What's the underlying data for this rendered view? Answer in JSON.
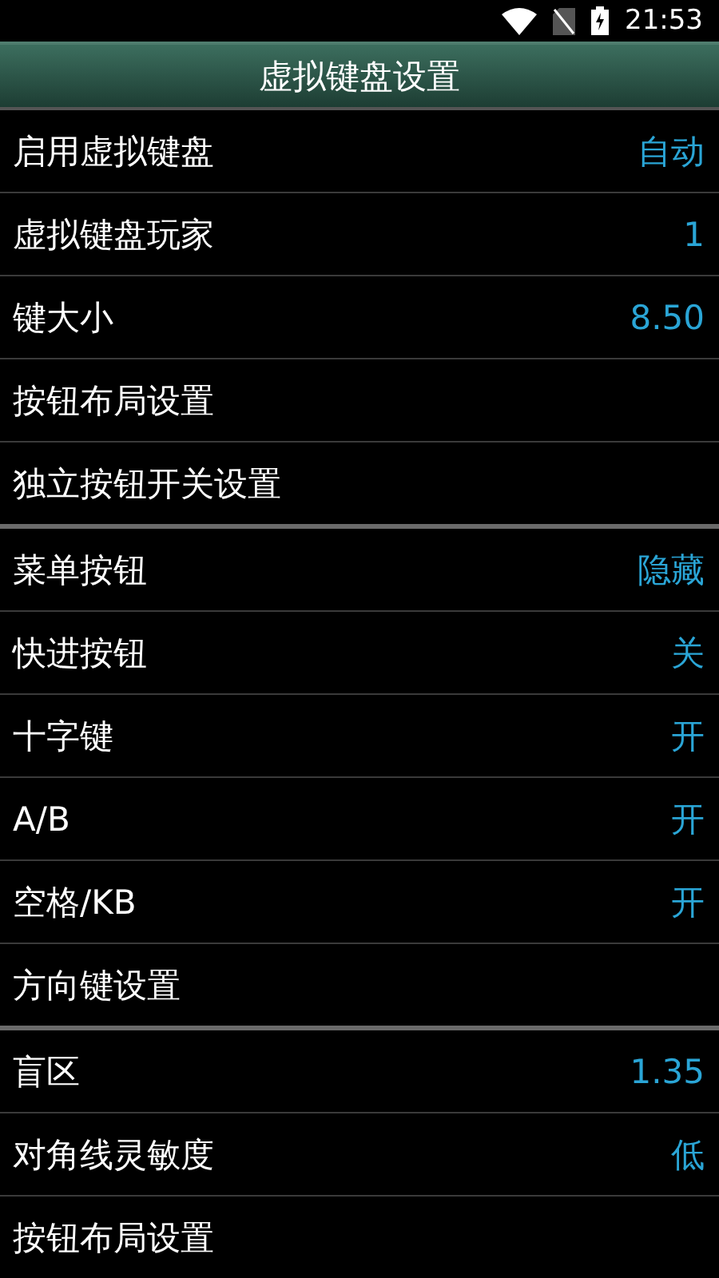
{
  "status_bar": {
    "time": "21:53"
  },
  "header": {
    "title": "虚拟键盘设置"
  },
  "groups": [
    {
      "items": [
        {
          "label": "启用虚拟键盘",
          "value": "自动"
        },
        {
          "label": "虚拟键盘玩家",
          "value": "1"
        },
        {
          "label": "键大小",
          "value": "8.50"
        },
        {
          "label": "按钮布局设置"
        },
        {
          "label": "独立按钮开关设置"
        }
      ]
    },
    {
      "items": [
        {
          "label": "菜单按钮",
          "value": "隐藏"
        },
        {
          "label": "快进按钮",
          "value": "关"
        },
        {
          "label": "十字键",
          "value": "开"
        },
        {
          "label": "A/B",
          "value": "开"
        },
        {
          "label": "空格/KB",
          "value": "开"
        },
        {
          "label": "方向键设置"
        }
      ]
    },
    {
      "items": [
        {
          "label": "盲区",
          "value": "1.35"
        },
        {
          "label": "对角线灵敏度",
          "value": "低"
        },
        {
          "label": "按钮布局设置"
        }
      ]
    }
  ]
}
